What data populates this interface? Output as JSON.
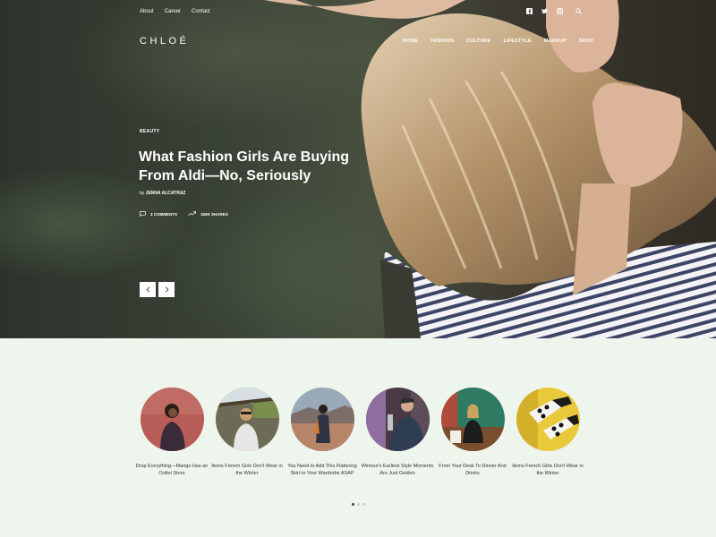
{
  "topnav": [
    "About",
    "Career",
    "Contact"
  ],
  "social": [
    "facebook-icon",
    "twitter-icon",
    "instagram-icon",
    "search-icon"
  ],
  "logo": "CHLOÉ",
  "mainnav": [
    "HOME",
    "FASHION",
    "CULTURE",
    "LIFESTYLE",
    "MAKEUP",
    "SHOP"
  ],
  "hero": {
    "category": "BEAUTY",
    "title": "What Fashion Girls Are Buying From Aldi—No, Seriously",
    "by": "by",
    "author": "JENNA ALCATRAZ",
    "comments": "3 COMMENTS",
    "shares": "160K SHARES"
  },
  "colors": {
    "page_bg": "#eef5ec",
    "text": "#333333"
  },
  "cards": [
    {
      "title": "Drop Everything—Mango Has an Outlet Store"
    },
    {
      "title": "Items French Girls Don't Wear in the Winter"
    },
    {
      "title": "You Need to Add This Flattering Skirt to Your Wardrobe ASAP"
    },
    {
      "title": "Wintour's Earliest Style Moments Are Just Golden"
    },
    {
      "title": "From Your Desk To Dinner And Drinks"
    },
    {
      "title": "Items French Girls Don't Wear in the Winter"
    }
  ],
  "pagination": {
    "pages": 3,
    "active": 1
  }
}
